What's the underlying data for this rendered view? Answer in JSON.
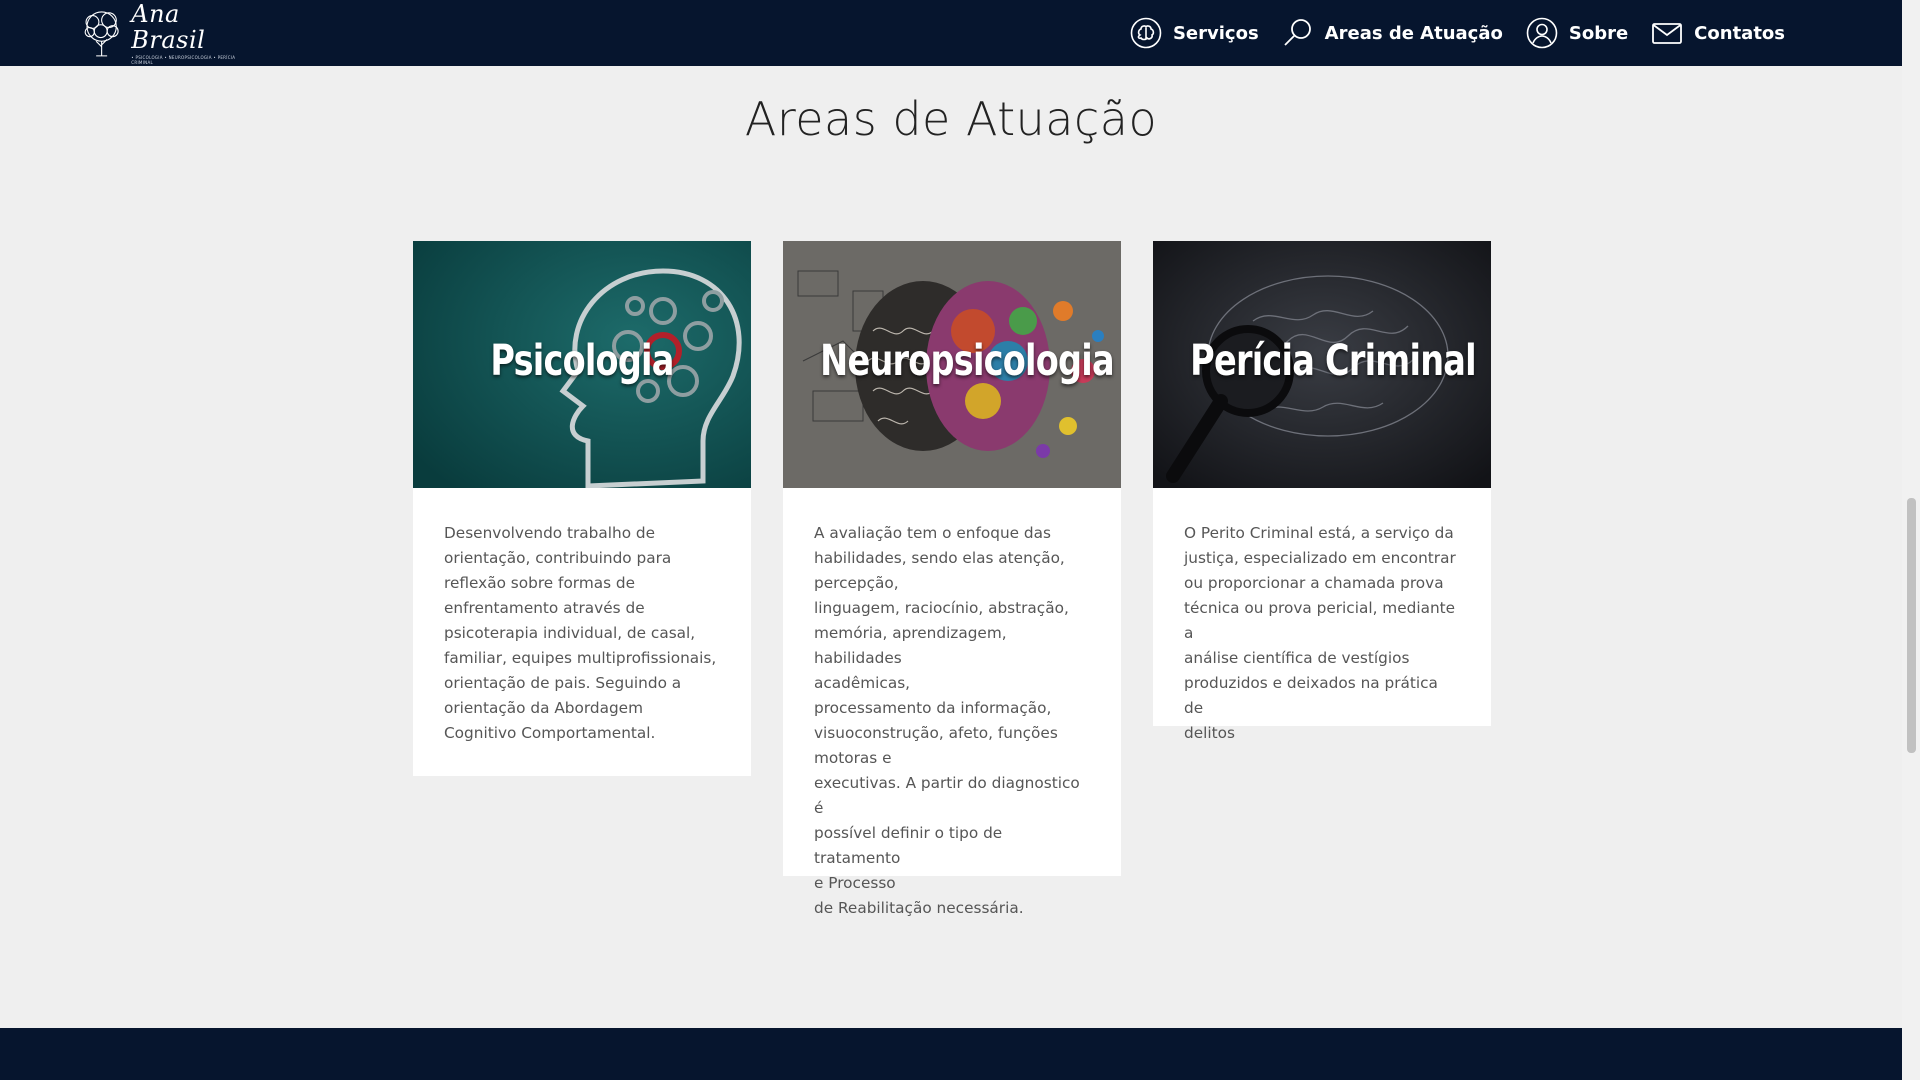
{
  "brand": {
    "name": "Ana Brasil",
    "tagline": "• PSICOLOGIA • NEUROPSICOLOGIA • PERÍCIA CRIMINAL"
  },
  "nav": {
    "items": [
      {
        "label": "Serviços",
        "icon": "brain-icon"
      },
      {
        "label": "Areas de Atuação",
        "icon": "magnifier-icon"
      },
      {
        "label": "Sobre",
        "icon": "user-icon"
      },
      {
        "label": "Contatos",
        "icon": "envelope-icon"
      }
    ]
  },
  "section": {
    "title": "Areas de Atuação"
  },
  "cards": [
    {
      "heading": "Psicologia",
      "text": "Desenvolvendo trabalho de\norientação, contribuindo para\nreflexão sobre formas de\nenfrentamento através de\npsicoterapia individual, de casal,\nfamiliar, equipes multiprofissionais,\norientação de pais. Seguindo a\norientação da Abordagem\nCognitivo Comportamental."
    },
    {
      "heading": "Neuropsicologia",
      "text": "A avaliação tem o enfoque das\nhabilidades, sendo elas atenção,\npercepção,\nlinguagem, raciocínio, abstração,\nmemória, aprendizagem, habilidades\nacadêmicas,\nprocessamento da informação,\nvisuoconstrução, afeto, funções\nmotoras e\nexecutivas. A partir do diagnostico é\npossível definir o tipo de tratamento\ne Processo\nde Reabilitação necessária."
    },
    {
      "heading": "Perícia Criminal",
      "text": "O Perito Criminal está, a serviço da\njustiça, especializado em encontrar\nou proporcionar a chamada prova\ntécnica ou prova pericial, mediante a\nanálise científica de vestígios\nproduzidos e deixados na prática de\ndelitos"
    }
  ],
  "colors": {
    "navbar": "#06152e",
    "background": "#efefef",
    "card": "#ffffff",
    "text": "#565656"
  }
}
